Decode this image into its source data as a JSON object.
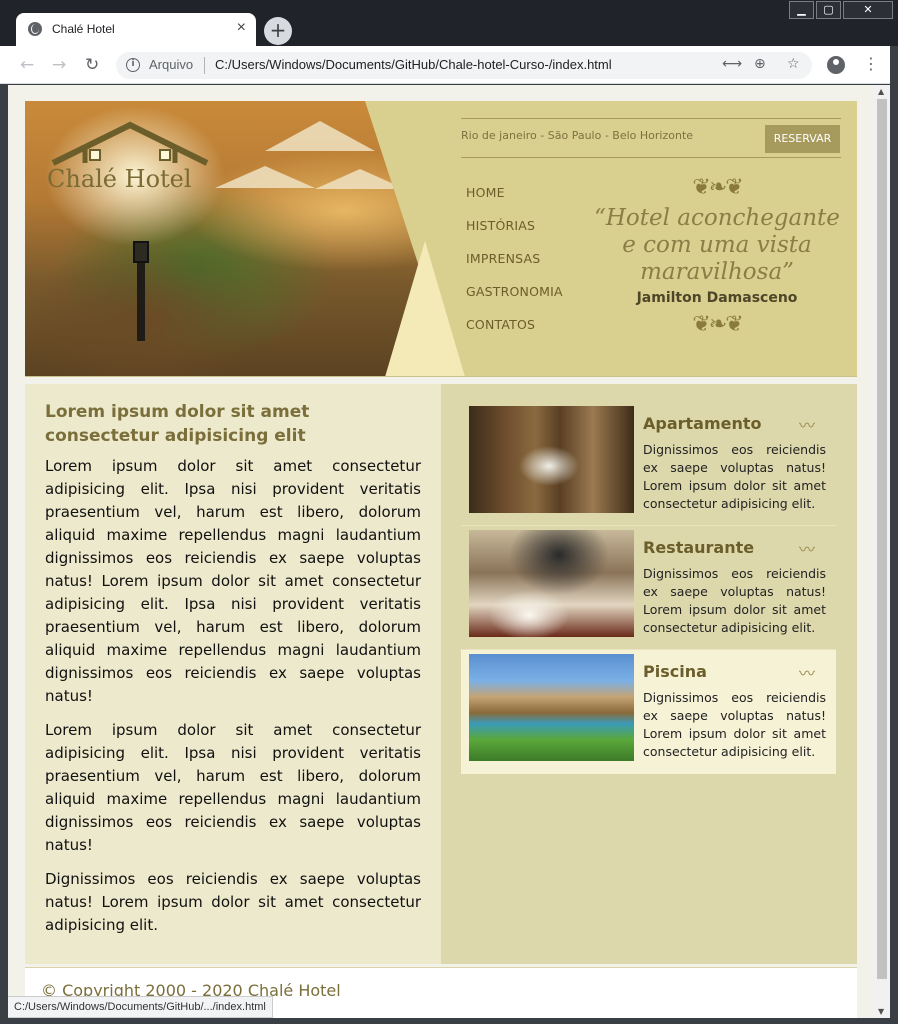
{
  "browser": {
    "tab_title": "Chalé Hotel",
    "tab_close": "×",
    "new_tab": "+",
    "window_minimize": "▁",
    "window_maximize": "▢",
    "window_close": "✕",
    "url_scheme_label": "Arquivo",
    "url": "C:/Users/Windows/Documents/GitHub/Chale-hotel-Curso-/index.html",
    "status_url": "C:/Users/Windows/Documents/GitHub/.../index.html",
    "back": "←",
    "forward": "→",
    "reload": "↻",
    "translate_icon": "⟷",
    "zoom_icon": "⊕",
    "bookmark_icon": "☆",
    "menu_icon": "⋮"
  },
  "header": {
    "logo_text": "Chalé Hotel",
    "cities": "Rio de janeiro - São Paulo - Belo Horizonte",
    "reserve_label": "RESERVAR",
    "menu": [
      "HOME",
      "HISTÓRIAS",
      "IMPRENSAS",
      "GASTRONOMIA",
      "CONTATOS"
    ],
    "quote": "“Hotel aconchegante e com uma vista maravilhosa”",
    "quote_author": "Jamilton Damasceno",
    "ornament": "❦❧❦"
  },
  "main": {
    "heading": "Lorem ipsum dolor sit amet consectetur adipisicing elit",
    "paragraphs": [
      "Lorem ipsum dolor sit amet consectetur adipisicing elit. Ipsa nisi provident veritatis praesentium vel, harum est libero, dolorum aliquid maxime repellendus magni laudantium dignissimos eos reiciendis ex saepe voluptas natus! Lorem ipsum dolor sit amet consectetur adipisicing elit. Ipsa nisi provident veritatis praesentium vel, harum est libero, dolorum aliquid maxime repellendus magni laudantium dignissimos eos reiciendis ex saepe voluptas natus!",
      "Lorem ipsum dolor sit amet consectetur adipisicing elit. Ipsa nisi provident veritatis praesentium vel, harum est libero, dolorum aliquid maxime repellendus magni laudantium dignissimos eos reiciendis ex saepe voluptas natus!",
      "Dignissimos eos reiciendis ex saepe voluptas natus! Lorem ipsum dolor sit amet consectetur adipisicing elit."
    ]
  },
  "sidebar": {
    "cards": [
      {
        "title": "Apartamento",
        "text": "Dignissimos eos reiciendis ex saepe voluptas natus! Lorem ipsum dolor sit amet consectetur adipisicing elit."
      },
      {
        "title": "Restaurante",
        "text": "Dignissimos eos reiciendis ex saepe voluptas natus! Lorem ipsum dolor sit amet consectetur adipisicing elit."
      },
      {
        "title": "Piscina",
        "text": "Dignissimos eos reiciendis ex saepe voluptas natus! Lorem ipsum dolor sit amet consectetur adipisicing elit."
      }
    ],
    "wave": "〰"
  },
  "footer": {
    "copyright": "© Copyright 2000 - 2020 Chalé Hotel"
  },
  "colors": {
    "accent": "#a69a5c",
    "header_bg": "#d9cf8f",
    "heading": "#7a6e3a"
  }
}
